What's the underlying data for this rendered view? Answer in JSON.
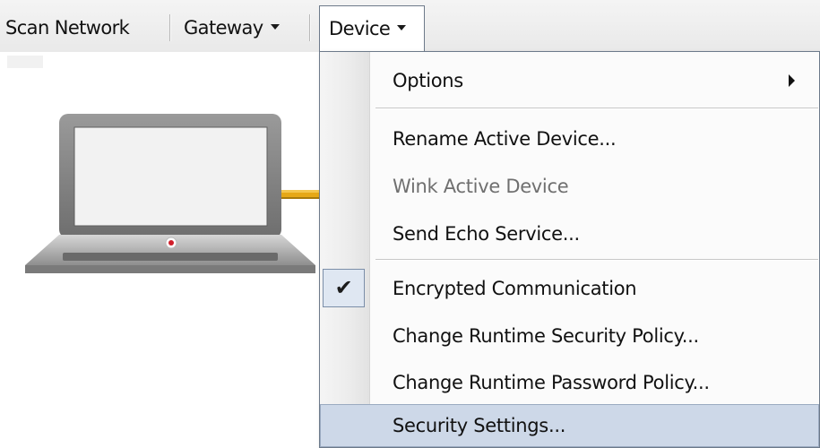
{
  "toolbar": {
    "scan_network": "Scan Network",
    "gateway": "Gateway",
    "device": "Device"
  },
  "menu": {
    "options": "Options",
    "rename_active_device": "Rename Active Device...",
    "wink_active_device": "Wink Active Device",
    "send_echo_service": "Send Echo Service...",
    "encrypted_communication": "Encrypted Communication",
    "encrypted_communication_checked": true,
    "change_runtime_security_policy": "Change Runtime Security Policy...",
    "change_runtime_password_policy": "Change Runtime Password Policy...",
    "security_settings": "Security Settings..."
  },
  "icons": {
    "checkmark": "✔"
  },
  "colors": {
    "menu_highlight": "#cdd8e8",
    "cable": "#e6a817",
    "status_led": "#d01f2a"
  }
}
